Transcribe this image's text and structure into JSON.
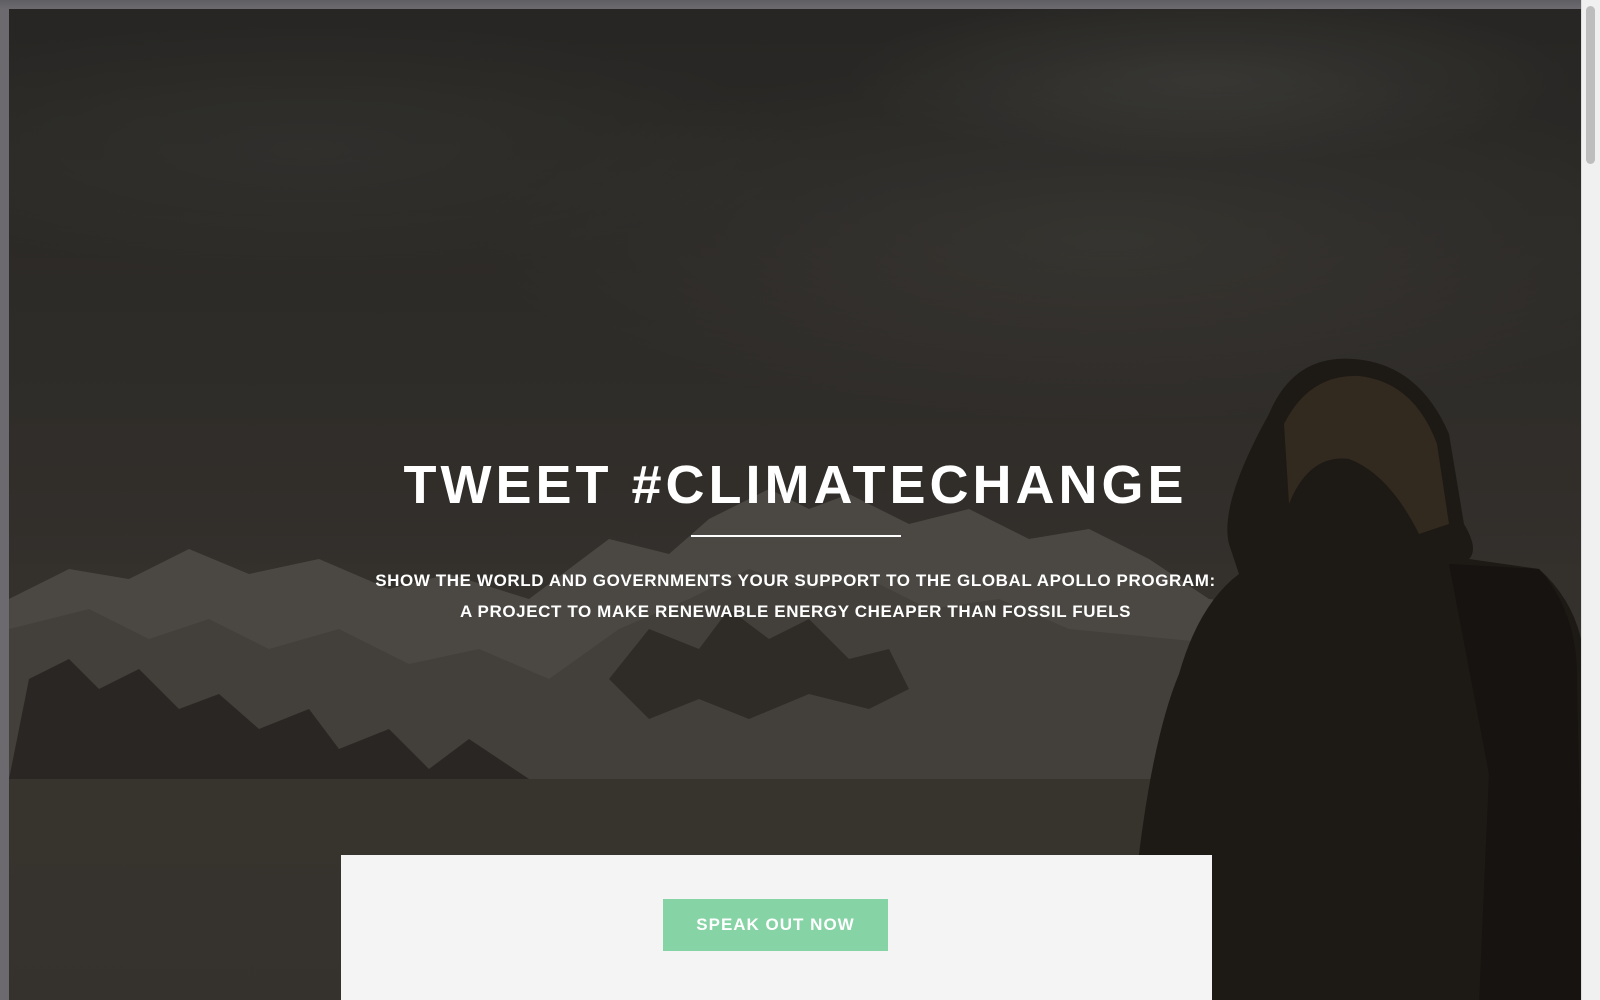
{
  "hero": {
    "title": "TWEET #CLIMATECHANGE",
    "subtitle_line1": "SHOW THE WORLD AND GOVERNMENTS YOUR SUPPORT TO THE GLOBAL APOLLO PROGRAM:",
    "subtitle_line2": "A PROJECT TO MAKE RENEWABLE ENERGY CHEAPER THAN FOSSIL FUELS"
  },
  "cta": {
    "label": "SPEAK OUT NOW"
  },
  "colors": {
    "cta_background": "#86d3a5",
    "hero_text": "#ffffff",
    "card_background": "#f4f4f4"
  },
  "icons": {
    "background": "mountain-hiker-photo"
  }
}
